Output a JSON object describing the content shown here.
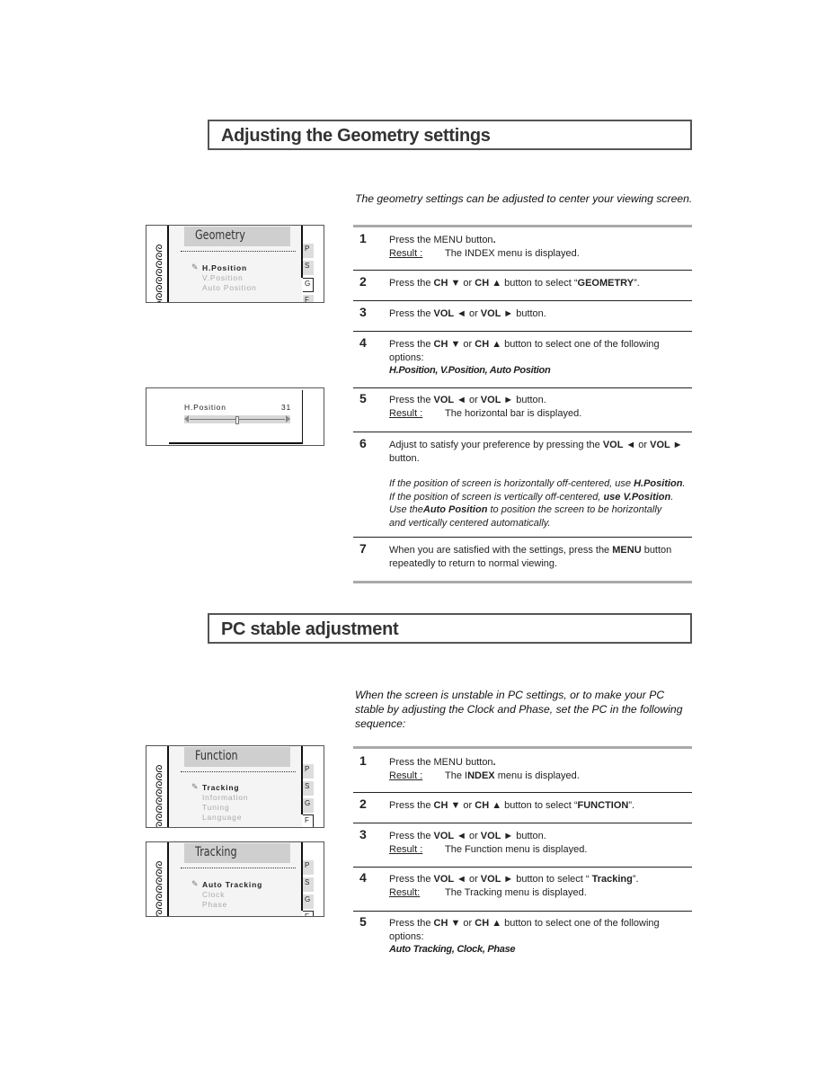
{
  "geometry_section": {
    "title": "Adjusting the Geometry settings",
    "intro": "The geometry settings can be adjusted to center your viewing screen.",
    "osd_menu": {
      "title": "Geometry",
      "items": [
        {
          "label": "H.Position",
          "selected": true
        },
        {
          "label": "V.Position",
          "selected": false
        },
        {
          "label": "Auto Position",
          "selected": false
        }
      ],
      "tabs": [
        "P",
        "S",
        "G",
        "F"
      ],
      "active_tab": "G"
    },
    "hposition_bar": {
      "label": "H.Position",
      "value": "31",
      "level_fraction": 0.5
    },
    "steps": [
      {
        "num": "1",
        "parts": [
          [
            "t",
            "Press the MENU button"
          ],
          [
            "b",
            "."
          ]
        ],
        "result_label": "Result :",
        "result": "The  INDEX menu is displayed."
      },
      {
        "num": "2",
        "parts": [
          [
            "t",
            "Press the  "
          ],
          [
            "b",
            "CH ▼"
          ],
          [
            "t",
            " or "
          ],
          [
            "b",
            "CH ▲"
          ],
          [
            "t",
            " button to select “"
          ],
          [
            "b",
            "GEOMETRY"
          ],
          [
            "t",
            "”."
          ]
        ]
      },
      {
        "num": "3",
        "parts": [
          [
            "t",
            "Press the "
          ],
          [
            "b",
            "VOL ◄"
          ],
          [
            "t",
            " or "
          ],
          [
            "b",
            "VOL ►"
          ],
          [
            "t",
            " button."
          ]
        ]
      },
      {
        "num": "4",
        "parts": [
          [
            "t",
            "Press the  "
          ],
          [
            "b",
            "CH ▼"
          ],
          [
            "t",
            " or "
          ],
          [
            "b",
            "CH ▲"
          ],
          [
            "t",
            " button to select one of the following options:"
          ]
        ],
        "options": "H.Position, V.Position, Auto Position"
      },
      {
        "num": "5",
        "parts": [
          [
            "t",
            "Press the  "
          ],
          [
            "b",
            "VOL ◄"
          ],
          [
            "t",
            " or "
          ],
          [
            "b",
            "VOL ►"
          ],
          [
            "t",
            " button."
          ]
        ],
        "result_label": "Result :",
        "result": "The horizontal bar is displayed."
      },
      {
        "num": "6",
        "parts": [
          [
            "t",
            "Adjust to satisfy your preference by pressing the "
          ],
          [
            "b",
            "VOL ◄"
          ],
          [
            "t",
            " or "
          ],
          [
            "b",
            "VOL ►"
          ],
          [
            "t",
            " button."
          ]
        ],
        "notes": [
          [
            [
              "t",
              "If the position of screen is horizontally off-centered, use "
            ],
            [
              "b",
              "H.Position"
            ],
            [
              "t",
              "."
            ]
          ],
          [
            [
              "t",
              "If the position of screen is vertically off-centered, "
            ],
            [
              "b",
              "use V.Position"
            ],
            [
              "t",
              "."
            ]
          ],
          [
            [
              "t",
              "Use the"
            ],
            [
              "b",
              "Auto Position"
            ],
            [
              "t",
              " to position the screen to be horizontally"
            ]
          ],
          [
            [
              "t",
              "and vertically centered automatically."
            ]
          ]
        ]
      },
      {
        "num": "7",
        "parts": [
          [
            "t",
            " When you are satisfied with the settings, press the  "
          ],
          [
            "b",
            "MENU"
          ],
          [
            "t",
            " button repeatedly to return to normal viewing."
          ]
        ]
      }
    ]
  },
  "pc_section": {
    "title": "PC stable adjustment",
    "intro": "When the screen is unstable in PC settings, or to make your PC stable by adjusting the Clock and Phase, set the PC in the following sequence:",
    "function_menu": {
      "title": "Function",
      "items": [
        {
          "label": "Tracking",
          "selected": true
        },
        {
          "label": "Information",
          "selected": false
        },
        {
          "label": "Tuning",
          "selected": false
        },
        {
          "label": "Language",
          "selected": false
        }
      ],
      "tabs": [
        "P",
        "S",
        "G",
        "F"
      ],
      "active_tab": "F"
    },
    "tracking_menu": {
      "title": "Tracking",
      "items": [
        {
          "label": "Auto Tracking",
          "selected": true
        },
        {
          "label": "Clock",
          "selected": false
        },
        {
          "label": "Phase",
          "selected": false
        }
      ],
      "tabs": [
        "P",
        "S",
        "G",
        "F"
      ],
      "active_tab": "F"
    },
    "steps": [
      {
        "num": "1",
        "parts": [
          [
            "t",
            "Press the MENU button"
          ],
          [
            "b",
            "."
          ]
        ],
        "result_label": "Result :",
        "result_parts": [
          [
            "t",
            "The I"
          ],
          [
            "b",
            "NDEX"
          ],
          [
            "t",
            " menu is displayed."
          ]
        ]
      },
      {
        "num": "2",
        "parts": [
          [
            "t",
            "Press the "
          ],
          [
            "b",
            "CH ▼"
          ],
          [
            "t",
            " or "
          ],
          [
            "b",
            "CH ▲"
          ],
          [
            "t",
            " button to select “"
          ],
          [
            "b",
            "FUNCTION"
          ],
          [
            "t",
            "”."
          ]
        ]
      },
      {
        "num": "3",
        "parts": [
          [
            "t",
            "Press the "
          ],
          [
            "b",
            "VOL ◄"
          ],
          [
            "t",
            " or "
          ],
          [
            "b",
            "VOL ►"
          ],
          [
            "t",
            " button."
          ]
        ],
        "result_label": "Result :",
        "result": "The Function menu is displayed."
      },
      {
        "num": "4",
        "parts": [
          [
            "t",
            "Press the "
          ],
          [
            "b",
            "VOL ◄"
          ],
          [
            "t",
            " or  "
          ],
          [
            "b",
            "VOL ►"
          ],
          [
            "t",
            " button to select “ "
          ],
          [
            "b",
            "Tracking"
          ],
          [
            "t",
            "”."
          ]
        ],
        "result_label": "Result:",
        "result": "The Tracking menu is displayed."
      },
      {
        "num": "5",
        "parts": [
          [
            "t",
            "Press the "
          ],
          [
            "b",
            "CH ▼"
          ],
          [
            "t",
            " or "
          ],
          [
            "b",
            "CH ▲"
          ],
          [
            "t",
            " button to select one of the following options:"
          ]
        ],
        "options": "Auto Tracking, Clock, Phase"
      }
    ]
  }
}
